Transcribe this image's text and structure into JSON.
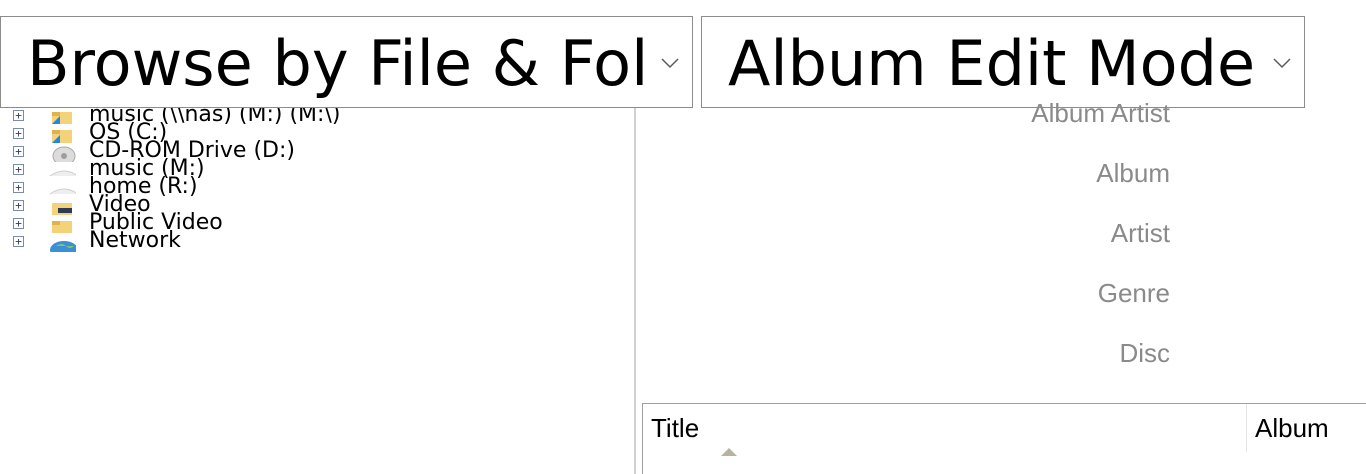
{
  "mode_selector": {
    "value": "Browse by File & Folder"
  },
  "edit_selector": {
    "value": "Album Edit Mode"
  },
  "tree": {
    "items": [
      {
        "label": "music (\\\\nas) (M:) (M:\\)",
        "icon": "network-drive-icon",
        "expander": "+"
      },
      {
        "label": "OS (C:)",
        "icon": "folder-shortcut-icon",
        "expander": "+"
      },
      {
        "label": "CD-ROM Drive (D:)",
        "icon": "cd-drive-icon",
        "expander": "+"
      },
      {
        "label": "music (M:)",
        "icon": "network-drive-icon",
        "expander": "+"
      },
      {
        "label": "home (R:)",
        "icon": "network-drive-icon",
        "expander": "+"
      },
      {
        "label": "Video",
        "icon": "video-folder-icon",
        "expander": "+"
      },
      {
        "label": "Public Video",
        "icon": "folder-icon",
        "expander": "+"
      },
      {
        "label": "Network",
        "icon": "network-globe-icon",
        "expander": "+"
      }
    ]
  },
  "fields": {
    "album_artist": "Album Artist",
    "album": "Album",
    "artist": "Artist",
    "genre": "Genre",
    "disc": "Disc"
  },
  "tracklist": {
    "columns": {
      "title": "Title",
      "album": "Album"
    },
    "sort_column": "Title",
    "sort_direction": "ascending"
  },
  "colors": {
    "label_gray": "#8a8a8a",
    "border": "#8c8c8c",
    "expander": "#2b3c64"
  }
}
